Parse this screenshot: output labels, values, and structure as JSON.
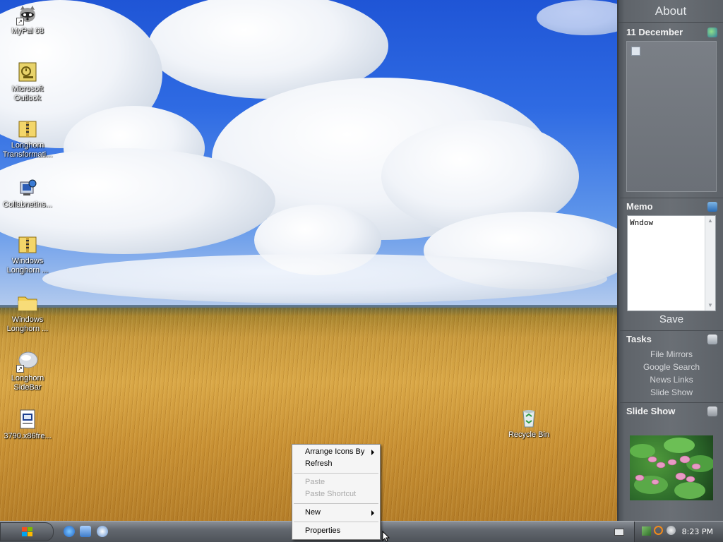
{
  "desktop": {
    "icons": [
      {
        "label": "MyPal 68",
        "icon": "raccoon-icon",
        "shortcut": true
      },
      {
        "label": "Microsoft Outlook",
        "icon": "outlook-icon",
        "shortcut": false
      },
      {
        "label": "Longhorn Transformati...",
        "icon": "zip-folder-icon",
        "shortcut": false
      },
      {
        "label": "Collabnetins...",
        "icon": "installer-icon",
        "shortcut": false
      },
      {
        "label": "Windows Longhorn ...",
        "icon": "zip-folder-icon",
        "shortcut": false
      },
      {
        "label": "Windows Longhorn ...",
        "icon": "folder-icon",
        "shortcut": false
      },
      {
        "label": "Longhorn SideBar",
        "icon": "sidebar-icon",
        "shortcut": true
      },
      {
        "label": "3790.x86fre...",
        "icon": "setup-file-icon",
        "shortcut": false
      }
    ],
    "recycle_bin": {
      "label": "Recycle Bin",
      "icon": "recycle-bin-icon"
    }
  },
  "sidebar": {
    "title": "About",
    "date": {
      "label": "11 December",
      "icon": "globe-icon"
    },
    "memo": {
      "label": "Memo",
      "icon": "notepad-icon",
      "text": "Wndow",
      "save_label": "Save"
    },
    "tasks": {
      "label": "Tasks",
      "icon": "tasks-icon",
      "items": [
        "File Mirrors",
        "Google Search",
        "News Links",
        "Slide Show"
      ]
    },
    "slideshow": {
      "label": "Slide Show",
      "icon": "trash-icon"
    }
  },
  "context_menu": {
    "items": [
      {
        "label": "Arrange Icons By",
        "submenu": true,
        "disabled": false
      },
      {
        "label": "Refresh",
        "submenu": false,
        "disabled": false
      },
      {
        "label": "Paste",
        "submenu": false,
        "disabled": true
      },
      {
        "label": "Paste Shortcut",
        "submenu": false,
        "disabled": true
      },
      {
        "label": "New",
        "submenu": true,
        "disabled": false
      },
      {
        "label": "Properties",
        "submenu": false,
        "disabled": false
      }
    ]
  },
  "taskbar": {
    "start_icon": "windows-flag-icon",
    "quick_launch": [
      "internet-explorer-icon",
      "desktop-icon",
      "media-player-icon"
    ],
    "tray_icons": [
      "keyboard-icon",
      "network-icon",
      "search-icon",
      "volume-icon"
    ],
    "clock": "8:23 PM"
  },
  "colors": {
    "sidebar_bg": "#6a6f75",
    "taskbar_bg": "#62676e",
    "menu_bg": "#f5f5f5"
  }
}
